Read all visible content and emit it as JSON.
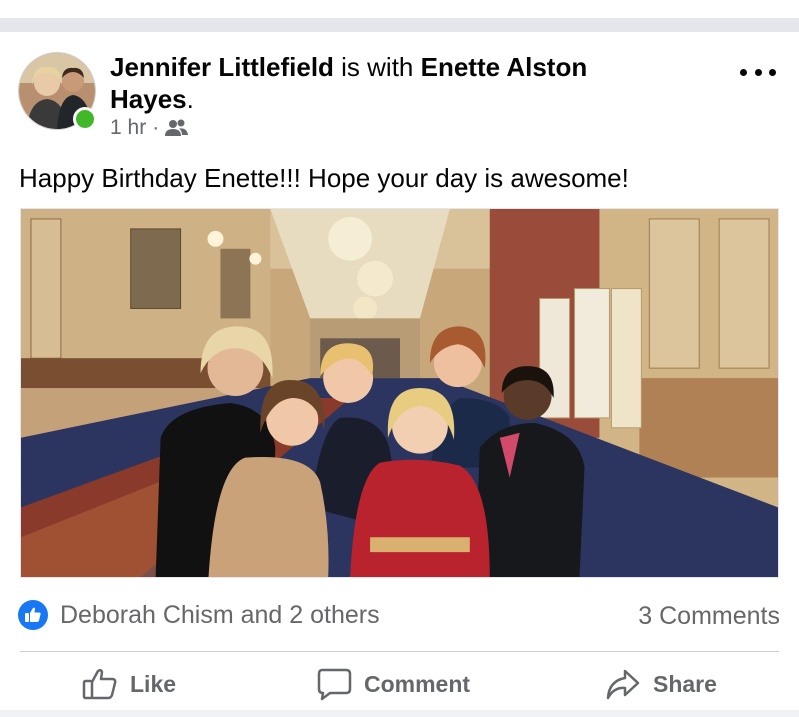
{
  "post": {
    "author": "Jennifer Littlefield",
    "with_text": " is with ",
    "tagged": "Enette Alston Hayes",
    "period": ".",
    "time": "1 hr",
    "separator": "·",
    "audience_icon": "friends-icon",
    "text": "Happy Birthday Enette!!! Hope your day is awesome!",
    "photo_description_icon": "group-photo"
  },
  "engagement": {
    "reaction_icon": "like-icon",
    "reactions_text": "Deborah Chism and 2 others",
    "comments_text": "3 Comments"
  },
  "actions": {
    "like_label": "Like",
    "comment_label": "Comment",
    "share_label": "Share"
  },
  "colors": {
    "brand_blue": "#1877f2",
    "online_green": "#42b72a",
    "secondary_text": "#65676b"
  }
}
